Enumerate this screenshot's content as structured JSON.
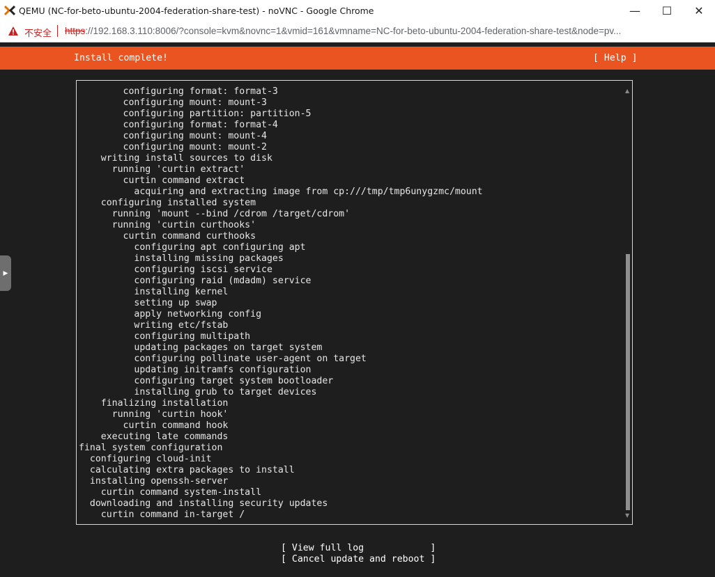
{
  "browser": {
    "window_title": "QEMU (NC-for-beto-ubuntu-2004-federation-share-test) - noVNC - Google Chrome",
    "security_label": "不安全",
    "url_scheme": "https",
    "url_rest": "://192.168.3.110:8006/?console=kvm&novnc=1&vmid=161&vmname=NC-for-beto-ubuntu-2004-federation-share-test&node=pv...",
    "controls": {
      "minimize": "—",
      "maximize": "☐",
      "close": "✕"
    }
  },
  "installer": {
    "header_title": "Install complete!",
    "help_label": "[ Help ]",
    "log_lines": [
      "        configuring format: format-3",
      "        configuring mount: mount-3",
      "        configuring partition: partition-5",
      "        configuring format: format-4",
      "        configuring mount: mount-4",
      "        configuring mount: mount-2",
      "    writing install sources to disk",
      "      running 'curtin extract'",
      "        curtin command extract",
      "          acquiring and extracting image from cp:///tmp/tmp6unygzmc/mount",
      "    configuring installed system",
      "      running 'mount --bind /cdrom /target/cdrom'",
      "      running 'curtin curthooks'",
      "        curtin command curthooks",
      "          configuring apt configuring apt",
      "          installing missing packages",
      "          configuring iscsi service",
      "          configuring raid (mdadm) service",
      "          installing kernel",
      "          setting up swap",
      "          apply networking config",
      "          writing etc/fstab",
      "          configuring multipath",
      "          updating packages on target system",
      "          configuring pollinate user-agent on target",
      "          updating initramfs configuration",
      "          configuring target system bootloader",
      "          installing grub to target devices",
      "    finalizing installation",
      "      running 'curtin hook'",
      "        curtin command hook",
      "    executing late commands",
      "final system configuration",
      "  configuring cloud-init",
      "  calculating extra packages to install",
      "  installing openssh-server",
      "    curtin command system-install",
      "  downloading and installing security updates",
      "    curtin command in-target /"
    ],
    "buttons": {
      "view_log": "[ View full log            ]",
      "cancel_reboot": "[ Cancel update and reboot ]"
    }
  },
  "colors": {
    "header": "#e95420",
    "console_bg": "#1e1e1e",
    "text": "#e6e6e6",
    "warning": "#c5221f"
  }
}
